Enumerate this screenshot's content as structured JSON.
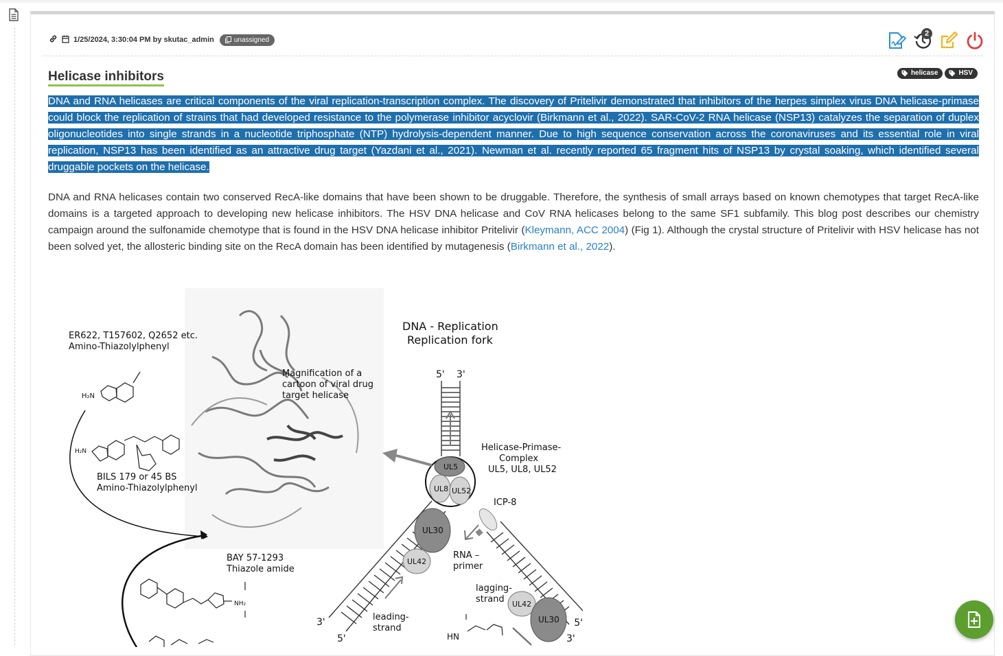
{
  "entry": {
    "timestamp": "1/25/2024, 3:30:04 PM",
    "by_word": "by",
    "author": "skutac_admin",
    "assignment_badge": "unassigned",
    "history_count": "2",
    "title": "Helicase inhibitors",
    "tags": [
      "helicase",
      "HSV"
    ]
  },
  "paragraph1": "DNA and RNA helicases are critical components of the viral replication-transcription complex. The discovery of Pritelivir demonstrated that inhibitors of the herpes simplex virus DNA helicase-primase could block the replication of strains that had developed resistance to the polymerase inhibitor acyclovir (Birkmann et al., 2022). SAR-CoV-2 RNA helicase (NSP13) catalyzes the separation of duplex oligonucleotides into single strands in a nucleotide triphosphate (NTP) hydrolysis-dependent manner. Due to high sequence conservation across the coronaviruses and its essential role in viral replication, NSP13 has been identified as an attractive drug target (Yazdani et al., 2021). Newman et al. recently reported 65 fragment hits of NSP13 by crystal soaking, which identified several druggable pockets on the helicase.",
  "paragraph2": {
    "part1": "DNA and RNA helicases contain two conserved RecA-like domains that have been shown to be druggable. Therefore, the synthesis of small arrays based on known chemotypes that target RecA-like domains is a targeted approach to developing new helicase inhibitors. The HSV DNA helicase and CoV RNA helicases belong to the same SF1 subfamily. This blog post describes our chemistry campaign around the sulfonamide chemotype that is found in the HSV DNA helicase inhibitor Pritelivir (",
    "link1": "Kleymann, ACC 2004",
    "part2": ") (Fig 1). Although the crystal structure of Pritelivir with HSV helicase has not been solved yet, the allosteric binding site on the RecA domain has been identified by mutagenesis (",
    "link2": "Birkmann et al., 2022",
    "part3": ")."
  },
  "figure": {
    "compound1_ids": "ER622, T157602, Q2652 etc.",
    "compound1_class": "Amino-Thiazolylphenyl",
    "compound2_ids": "BILS 179 or 45 BS",
    "compound2_class": "Amino-Thiazolylphenyl",
    "compound3_ids": "BAY 57-1293",
    "compound3_class": "Thiazole amide",
    "magnification_l1": "Magnification of a",
    "magnification_l2": "cartoon of viral drug",
    "magnification_l3": "target helicase",
    "fork_title_l1": "DNA - Replication",
    "fork_title_l2": "Replication fork",
    "five_prime": "5'",
    "three_prime": "3'",
    "hpc_l1": "Helicase-Primase-",
    "hpc_l2": "Complex",
    "hpc_l3": "UL5, UL8, UL52",
    "icp8": "ICP-8",
    "ul5": "UL5",
    "ul8": "UL8",
    "ul52": "UL52",
    "ul30": "UL30",
    "ul42": "UL42",
    "rna_primer_l1": "RNA –",
    "rna_primer_l2": "primer",
    "leading_l1": "leading-",
    "leading_l2": "strand",
    "lagging_l1": "lagging-",
    "lagging_l2": "strand",
    "h2n": "H₂N",
    "nh2": "NH₂",
    "hn": "HN"
  },
  "colors": {
    "highlight": "#1f6fad",
    "link": "#2a7fc9",
    "title_underline": "#8cc34a",
    "fab": "#5c9f2e",
    "icon_edit_blue": "#2a8fd4",
    "icon_edit_yellow": "#f2b31a",
    "icon_power": "#e03e3e"
  },
  "icons": [
    "document-icon",
    "link-icon",
    "calendar-icon",
    "copy-icon",
    "signature-edit-icon",
    "history-icon",
    "edit-icon",
    "power-icon",
    "tag-icon",
    "add-document-icon"
  ]
}
